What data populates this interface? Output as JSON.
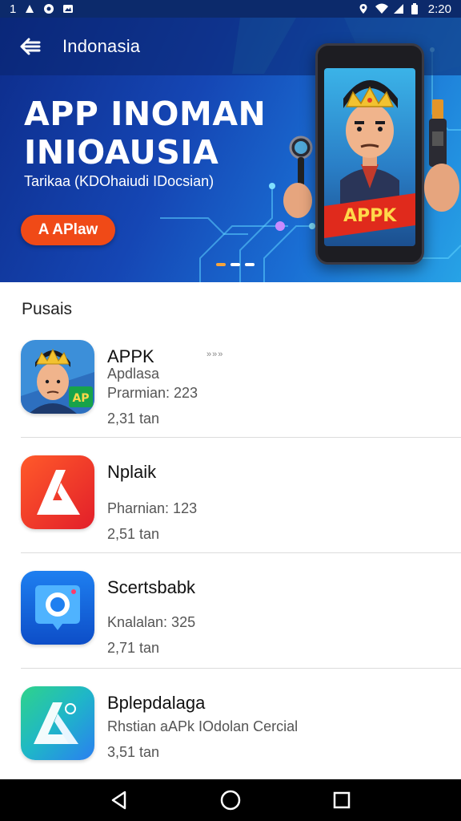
{
  "status_bar": {
    "left_text": "1",
    "time": "2:20"
  },
  "header": {
    "title": "Indonasia"
  },
  "hero": {
    "headline_line1": "APP INOMAN",
    "headline_line2": "INIOAUSIA",
    "subtitle": "Tarikaa (KDOhaiudi IDocsian)",
    "cta_label": "A APlaw",
    "phone_badge": "APPK",
    "carousel_active_index": 0,
    "carousel_count": 3
  },
  "section": {
    "title": "Pusais"
  },
  "apps": [
    {
      "name": "APPK",
      "subtitle": "Apdlasa",
      "line1": "Prarmian: 223",
      "line2": "2,31 tan",
      "arrow": "»»»",
      "icon": "character-icon",
      "badge": "AP"
    },
    {
      "name": "Nplaik",
      "line1": "Pharnian: 123",
      "line2": "2,51 tan",
      "icon": "red-a-logo-icon"
    },
    {
      "name": "Scertsbabk",
      "line1": "Knalalan: 325",
      "line2": "2,71 tan",
      "icon": "camera-icon"
    },
    {
      "name": "Bplepdalaga",
      "line1": "Rhstian aAPk IOdolan Cercial",
      "line2": "3,51 tan",
      "icon": "gradient-a-logo-icon"
    }
  ],
  "colors": {
    "accent": "#f04a17",
    "hero_dark": "#0d2c8a",
    "hero_light": "#27a3e6"
  }
}
